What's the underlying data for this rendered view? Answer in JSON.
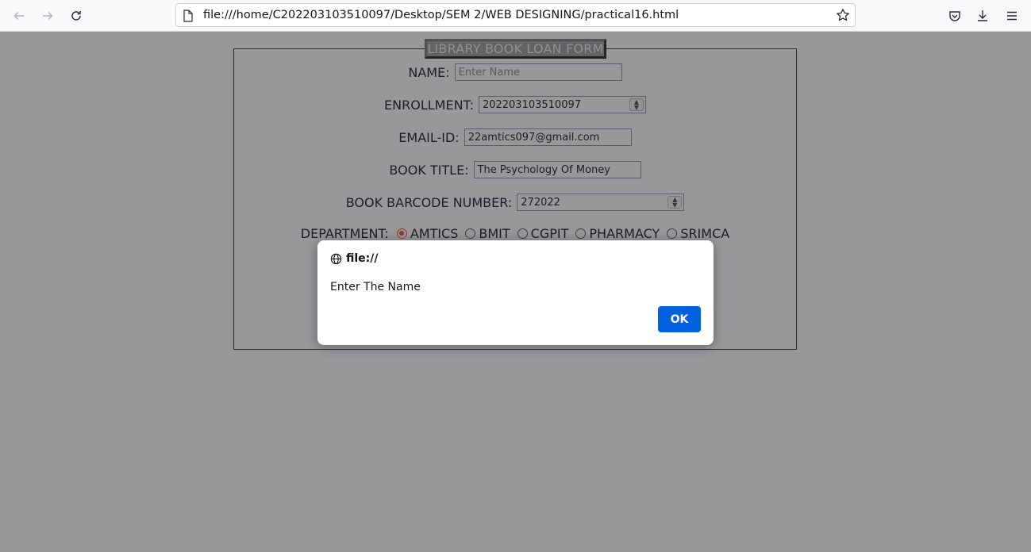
{
  "browser": {
    "url": "file:///home/C202203103510097/Desktop/SEM 2/WEB DESIGNING/practical16.html"
  },
  "form": {
    "legend": "LIBRARY BOOK LOAN FORM",
    "name_label": "NAME:",
    "name_placeholder": "Enter Name",
    "enrollment_label": "ENROLLMENT:",
    "enrollment_value": "202203103510097",
    "email_label": "EMAIL-ID:",
    "email_value": "22amtics097@gmail.com",
    "book_title_label": "BOOK TITLE:",
    "book_title_value": "The Psychology Of Money",
    "barcode_label": "BOOK BARCODE NUMBER:",
    "barcode_value": "272022",
    "department_label": "DEPARTMENT:",
    "departments": [
      "AMTICS",
      "BMIT",
      "CGPIT",
      "PHARMACY",
      "SRIMCA"
    ],
    "selected_department": "AMTICS"
  },
  "dialog": {
    "origin": "file://",
    "message": "Enter The Name",
    "ok_label": "OK"
  },
  "colors": {
    "accent": "#0061e0",
    "radio_selected": "#e0503a"
  }
}
